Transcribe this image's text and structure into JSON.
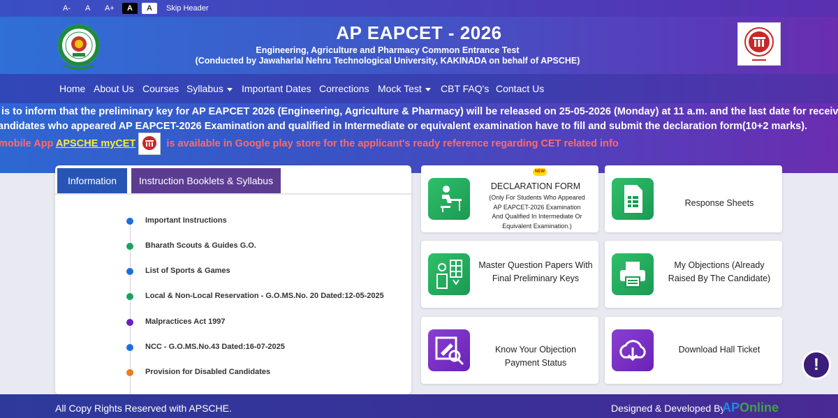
{
  "utility_bar": {
    "font_decrease": "A-",
    "font_normal": "A",
    "font_increase": "A+",
    "contrast_dark": "A",
    "contrast_light": "A",
    "skip_header": "Skip Header"
  },
  "header": {
    "title": "AP EAPCET - 2026",
    "subtitle_line1": "Engineering, Agriculture and Pharmacy Common Entrance Test",
    "subtitle_line2": "(Conducted by Jawaharlal Nehru Technological University, KAKINADA on behalf of APSCHE)"
  },
  "nav": {
    "items": [
      {
        "label": "Home"
      },
      {
        "label": "About Us"
      },
      {
        "label": "Courses"
      },
      {
        "label": "Syllabus"
      },
      {
        "label": "Important Dates"
      },
      {
        "label": "Corrections"
      },
      {
        "label": "Mock Test"
      },
      {
        "label": "CBT FAQ's"
      },
      {
        "label": "Contact Us"
      }
    ]
  },
  "announcements": {
    "line1": "is to inform that the preliminary key for AP EAPCET 2026 (Engineering, Agriculture & Pharmacy) will be released on 25-05-2026 (Monday) at 11 a.m. and the last date for receiving",
    "line2": "andidates who appeared AP EAPCET-2026 Examination and qualified in Intermediate or equivalent examination have to fill and submit the declaration form(10+2 marks).",
    "line3_prefix": "mobile App ",
    "line3_app": "APSCHE myCET",
    "line3_suffix": " is available in Google play store for the applicant's ready reference regarding CET related info"
  },
  "info_panel": {
    "tabs": [
      {
        "label": "Information"
      },
      {
        "label": "Instruction Booklets & Syllabus"
      }
    ],
    "items": [
      {
        "label": "Important Instructions",
        "color": "#1a6fe0"
      },
      {
        "label": "Bharath Scouts & Guides G.O.",
        "color": "#1aa35c"
      },
      {
        "label": "List of Sports & Games",
        "color": "#1a6fe0"
      },
      {
        "label": "Local & Non-Local Reservation - G.O.MS.No. 20 Dated:12-05-2025",
        "color": "#1aa35c"
      },
      {
        "label": "Malpractices Act 1997",
        "color": "#6a1fc0"
      },
      {
        "label": "NCC - G.O.MS.No.43 Dated:16-07-2025",
        "color": "#1a6fe0"
      },
      {
        "label": "Provision for Disabled Candidates",
        "color": "#f07a1a"
      }
    ]
  },
  "services": {
    "new_badge": "NEW",
    "declaration_title": "DECLARATION FORM",
    "declaration_note": "(Only For Students Who Appeared AP EAPCET-2026 Examination And Qualified In Intermediate Or Equivalent Examination.)",
    "response_sheets": "Response Sheets",
    "master_papers": "Master Question Papers With Final Preliminary Keys",
    "my_objections": "My Objections (Already Raised By The Candidate)",
    "objection_status": "Know Your Objection Payment Status",
    "hall_ticket": "Download Hall Ticket"
  },
  "help": {
    "label": "!"
  },
  "footer": {
    "copyright": "All Copy Rights Reserved with APSCHE.",
    "designed_by": "Designed & Developed By",
    "brand_ap": "AP",
    "brand_online": "Online"
  },
  "colors": {
    "header_blue": "#2f6fd6",
    "header_purple": "#6a2db0",
    "card_green": "#1a9a52",
    "card_purple": "#6a22b8",
    "alert_red": "#ff6b6b",
    "app_yellow": "#ffeb3b"
  }
}
